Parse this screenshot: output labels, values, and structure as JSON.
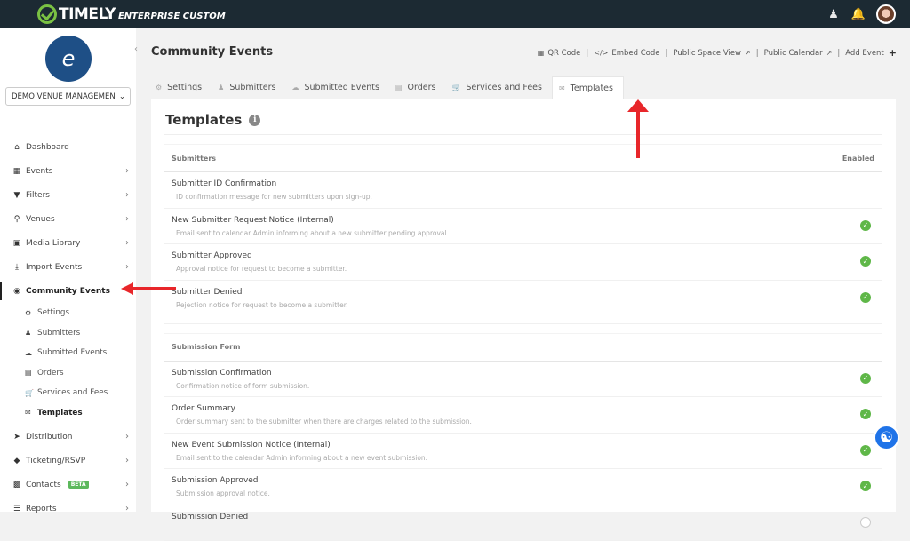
{
  "app": {
    "brand": "TIMELY",
    "edition": "ENTERPRISE CUSTOM",
    "brand_color": "#7ac143",
    "topbar_color": "#1c2a33"
  },
  "topbar": {
    "icons": [
      "support-agent-icon",
      "bell-icon",
      "user-avatar"
    ]
  },
  "sidebar": {
    "venue_select": "DEMO VENUE MANAGEMEN",
    "items": [
      {
        "label": "Dashboard",
        "icon": "home-icon",
        "chevron": false
      },
      {
        "label": "Events",
        "icon": "calendar-icon",
        "chevron": true
      },
      {
        "label": "Filters",
        "icon": "filter-icon",
        "chevron": true
      },
      {
        "label": "Venues",
        "icon": "map-marker-icon",
        "chevron": true
      },
      {
        "label": "Media Library",
        "icon": "image-icon",
        "chevron": true
      },
      {
        "label": "Import Events",
        "icon": "download-icon",
        "chevron": true
      },
      {
        "label": "Community Events",
        "icon": "globe-icon",
        "chevron": false,
        "active": true
      }
    ],
    "subitems": [
      {
        "label": "Settings",
        "icon": "cogs-icon"
      },
      {
        "label": "Submitters",
        "icon": "users-icon"
      },
      {
        "label": "Submitted Events",
        "icon": "cloud-upload-icon"
      },
      {
        "label": "Orders",
        "icon": "file-icon"
      },
      {
        "label": "Services and Fees",
        "icon": "cart-icon"
      },
      {
        "label": "Templates",
        "icon": "envelope-icon",
        "active": true
      }
    ],
    "items_bottom": [
      {
        "label": "Distribution",
        "icon": "paper-plane-icon",
        "chevron": true
      },
      {
        "label": "Ticketing/RSVP",
        "icon": "ticket-icon",
        "chevron": true
      },
      {
        "label": "Contacts",
        "icon": "contact-card-icon",
        "chevron": true,
        "badge": "BETA"
      },
      {
        "label": "Reports",
        "icon": "list-icon",
        "chevron": true
      }
    ]
  },
  "header": {
    "title": "Community Events",
    "actions": {
      "qr": "QR Code",
      "embed": "Embed Code",
      "space_view": "Public Space View",
      "calendar": "Public Calendar",
      "add": "Add Event"
    }
  },
  "tabs": [
    {
      "label": "Settings"
    },
    {
      "label": "Submitters"
    },
    {
      "label": "Submitted Events"
    },
    {
      "label": "Orders"
    },
    {
      "label": "Services and Fees"
    },
    {
      "label": "Templates",
      "active": true
    }
  ],
  "panel": {
    "title": "Templates",
    "enabled_header": "Enabled",
    "sections": [
      {
        "name": "Submitters",
        "rows": [
          {
            "title": "Submitter ID Confirmation",
            "desc": "ID confirmation message for new submitters upon sign-up.",
            "enabled": null
          },
          {
            "title": "New Submitter Request Notice (Internal)",
            "desc": "Email sent to calendar Admin informing about a new submitter pending approval.",
            "enabled": true
          },
          {
            "title": "Submitter Approved",
            "desc": "Approval notice for request to become a submitter.",
            "enabled": true
          },
          {
            "title": "Submitter Denied",
            "desc": "Rejection notice for request to become a submitter.",
            "enabled": true
          }
        ]
      },
      {
        "name": "Submission Form",
        "rows": [
          {
            "title": "Submission Confirmation",
            "desc": "Confirmation notice of form submission.",
            "enabled": true
          },
          {
            "title": "Order Summary",
            "desc": "Order summary sent to the submitter when there are charges related to the submission.",
            "enabled": true
          },
          {
            "title": "New Event Submission Notice (Internal)",
            "desc": "Email sent to the calendar Admin informing about a new event submission.",
            "enabled": true
          },
          {
            "title": "Submission Approved",
            "desc": "Submission approval notice.",
            "enabled": true
          },
          {
            "title": "Submission Denied",
            "desc": "",
            "enabled": false
          }
        ]
      }
    ]
  },
  "annotations": {
    "arrow_color": "#e8262a"
  }
}
